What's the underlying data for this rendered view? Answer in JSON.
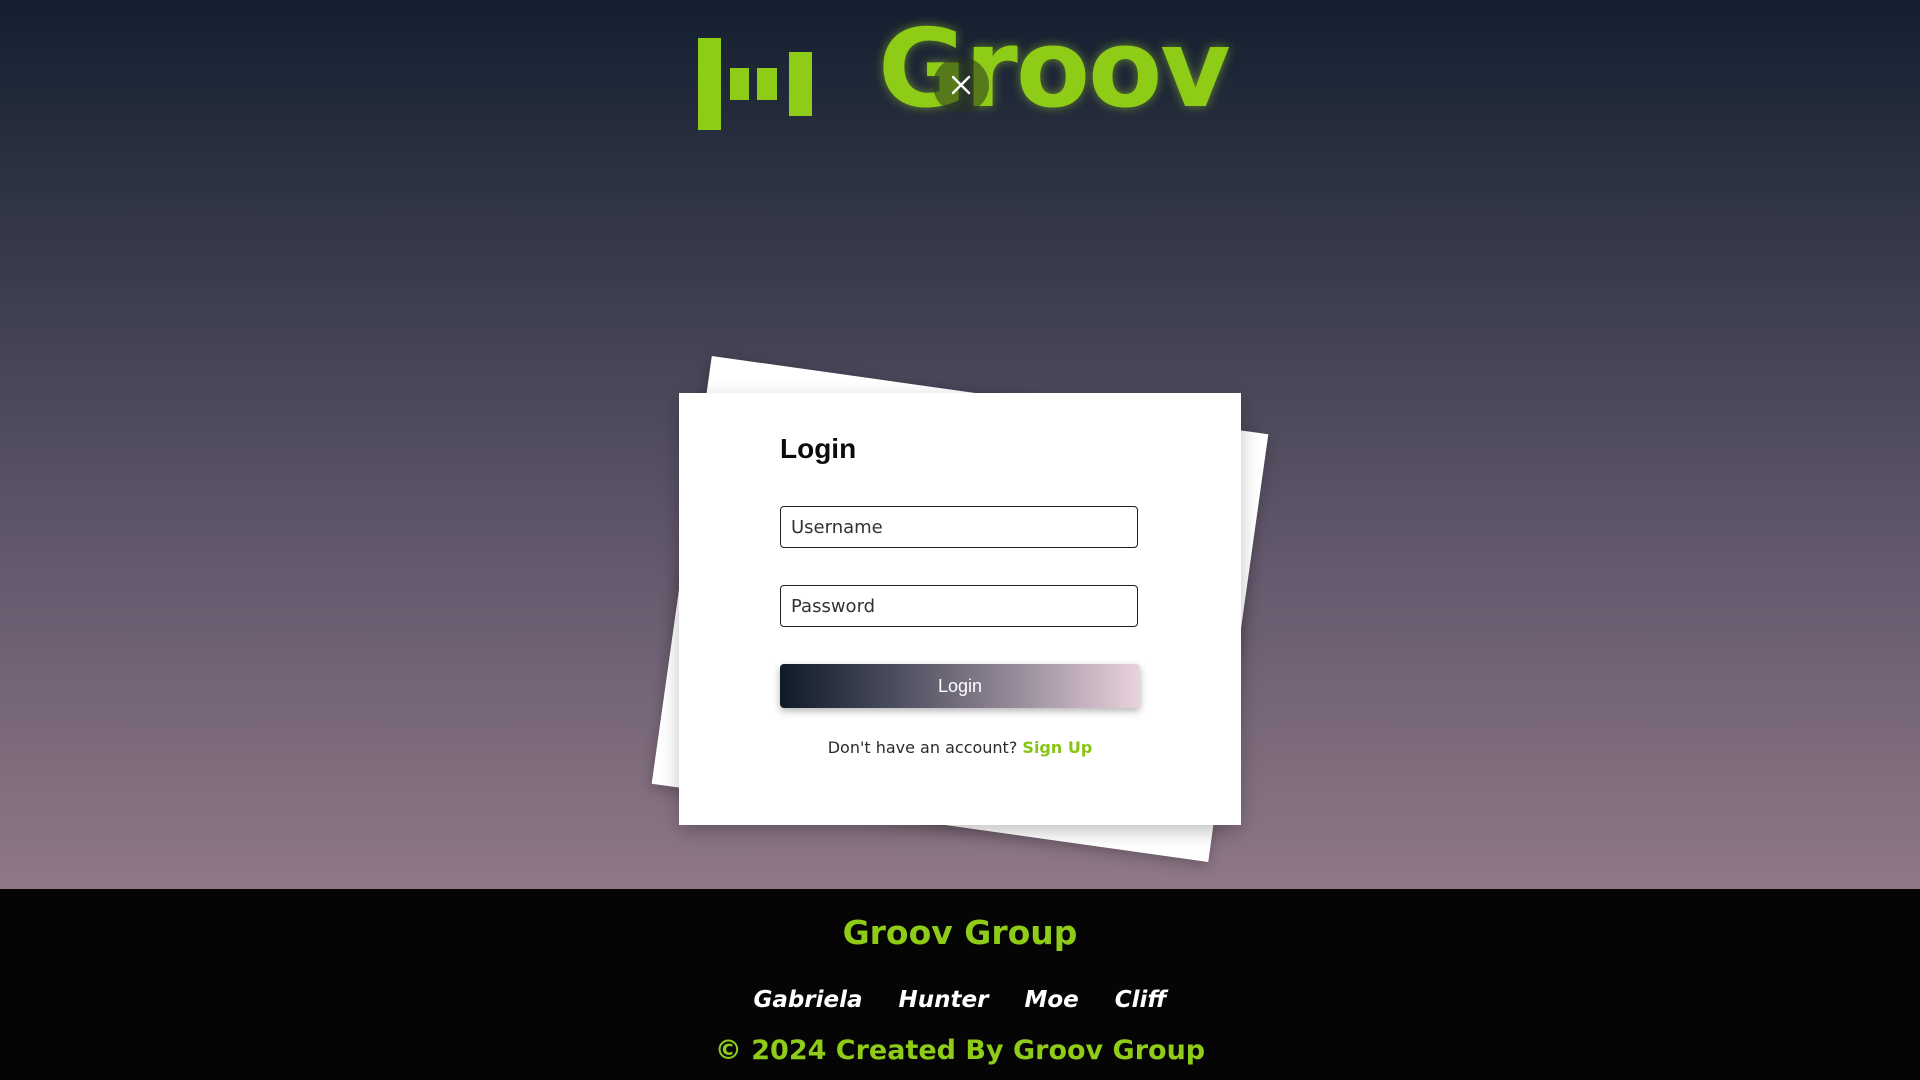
{
  "brand": {
    "name": "Groov",
    "accent_color": "#8fcc17",
    "logo_icon": "equalizer-bars-icon"
  },
  "overlay": {
    "close_icon": "close-icon"
  },
  "login": {
    "title": "Login",
    "username_placeholder": "Username",
    "password_placeholder": "Password",
    "button_label": "Login",
    "signup_prompt": "Don't have an account?",
    "signup_link": "Sign Up"
  },
  "footer": {
    "title": "Groov Group",
    "members": [
      "Gabriela",
      "Hunter",
      "Moe",
      "Cliff"
    ],
    "copyright": "© 2024 Created By Groov Group"
  }
}
